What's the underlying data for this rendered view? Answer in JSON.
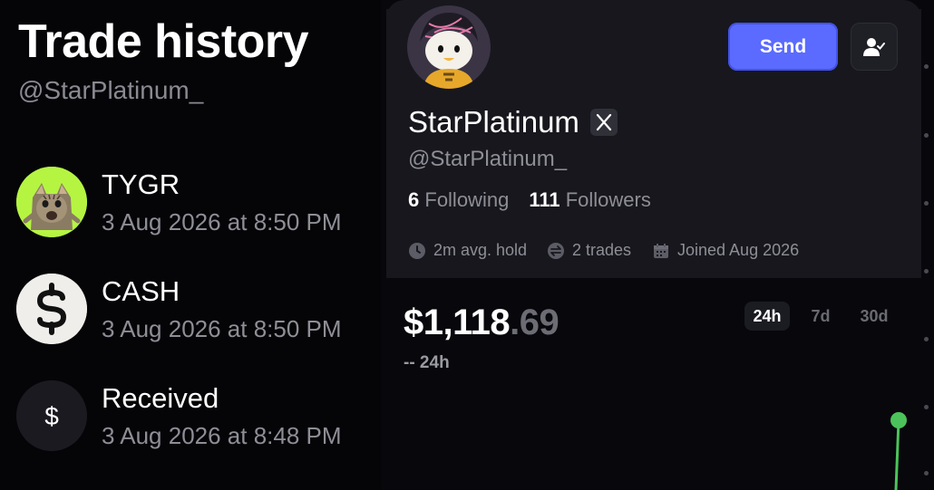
{
  "trade_history": {
    "title": "Trade history",
    "handle": "@StarPlatinum_",
    "items": [
      {
        "name": "TYGR",
        "time": "3 Aug 2026 at 8:50 PM",
        "icon": "cat-token-icon"
      },
      {
        "name": "CASH",
        "time": "3 Aug 2026 at 8:50 PM",
        "icon": "cash-token-icon"
      },
      {
        "name": "Received",
        "time": "3 Aug 2026 at 8:48 PM",
        "icon": "dollar-icon"
      }
    ]
  },
  "profile": {
    "name": "StarPlatinum",
    "handle": "@StarPlatinum_",
    "following_count": "6",
    "following_label": "Following",
    "followers_count": "111",
    "followers_label": "Followers",
    "avg_hold": "2m avg. hold",
    "trades": "2 trades",
    "joined": "Joined Aug 2026",
    "send_label": "Send"
  },
  "portfolio": {
    "balance_main": "$1,118",
    "balance_cents": ".69",
    "change": "-- 24h",
    "ranges": [
      "24h",
      "7d",
      "30d"
    ],
    "selected_range": "24h"
  },
  "colors": {
    "accent": "#5b6bff",
    "chart_line": "#4cc35a",
    "tygr_bg": "#b5f542"
  }
}
